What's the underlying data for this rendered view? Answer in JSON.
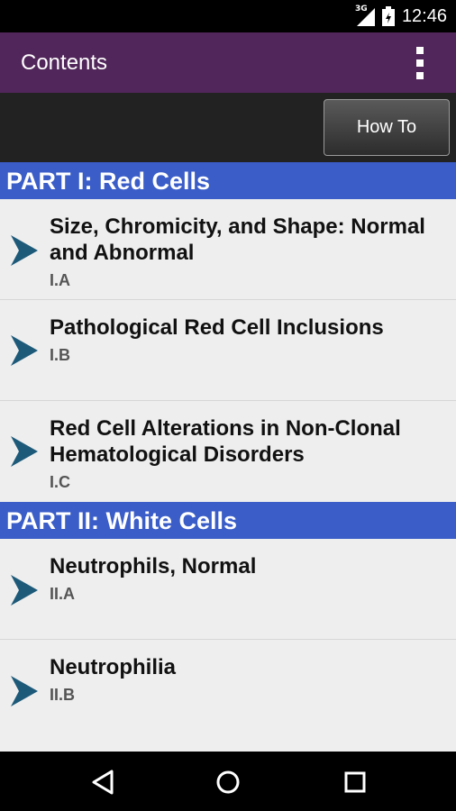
{
  "status_bar": {
    "time": "12:46",
    "network": "3G"
  },
  "app_bar": {
    "title": "Contents",
    "menu_icon": "overflow-menu-icon"
  },
  "toolbar": {
    "how_to_label": "How To"
  },
  "colors": {
    "app_bar": "#51265a",
    "section_header": "#3a5dc8",
    "chevron": "#1d5a79",
    "list_bg": "#eeeeee"
  },
  "sections": [
    {
      "title": "PART I: Red Cells",
      "items": [
        {
          "title": "Size, Chromicity, and Shape: Normal and Abnormal",
          "code": "I.A"
        },
        {
          "title": "Pathological Red Cell Inclusions",
          "code": "I.B"
        },
        {
          "title": "Red Cell Alterations in Non-Clonal Hematological Disorders",
          "code": "I.C"
        }
      ]
    },
    {
      "title": "PART II: White Cells",
      "items": [
        {
          "title": "Neutrophils, Normal",
          "code": "II.A"
        },
        {
          "title": "Neutrophilia",
          "code": "II.B"
        }
      ]
    }
  ],
  "nav_bar": {
    "back": "back-icon",
    "home": "home-icon",
    "recents": "recents-icon"
  }
}
